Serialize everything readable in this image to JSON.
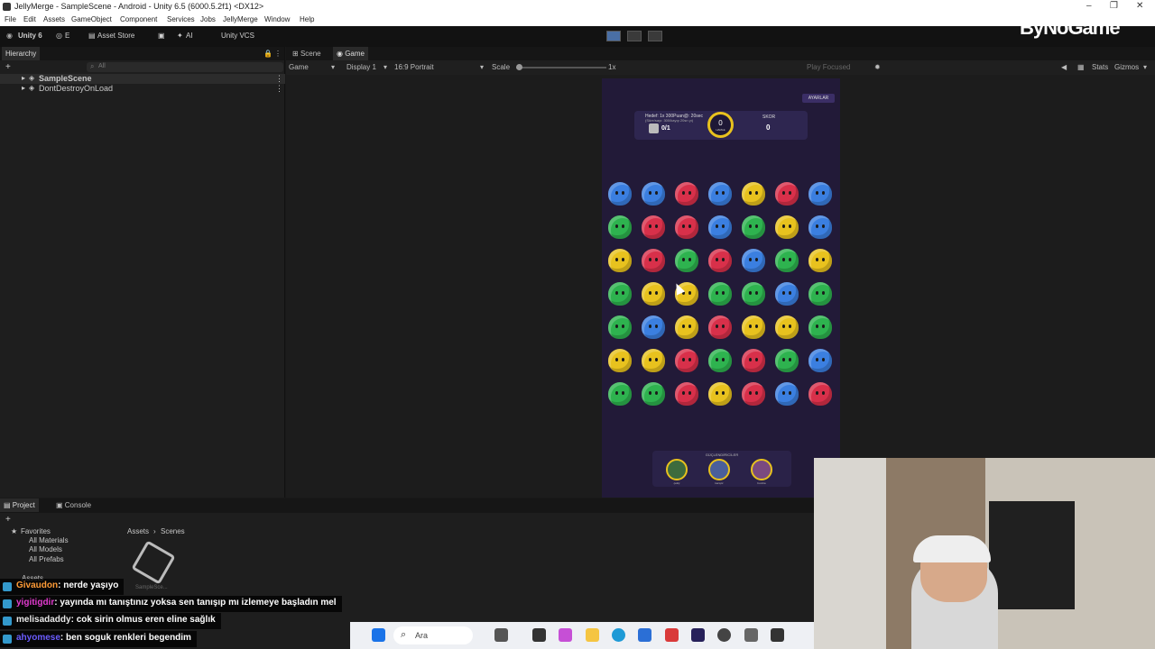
{
  "window": {
    "title": "JellyMerge - SampleScene - Android - Unity 6.5 (6000.5.2f1) <DX12>"
  },
  "menu": [
    "File",
    "Edit",
    "Assets",
    "GameObject",
    "Component",
    "Services",
    "Jobs",
    "JellyMerge",
    "Window",
    "Help"
  ],
  "toolbar": {
    "account": "Unity 6",
    "edit": "E",
    "asset_store": "Asset Store",
    "ai": "AI",
    "vcs": "Unity VCS"
  },
  "hierarchy": {
    "tab": "Hierarchy",
    "search_placeholder": "All",
    "items": [
      "SampleScene",
      "DontDestroyOnLoad"
    ]
  },
  "view_tabs": {
    "scene": "Scene",
    "game": "Game"
  },
  "game_bar": {
    "mode": "Game",
    "display": "Display 1",
    "aspect": "16:9 Portrait",
    "scale_label": "Scale",
    "scale_value": "1x",
    "play_focused": "Play Focused",
    "stats": "Stats",
    "gizmos": "Gizmos"
  },
  "game": {
    "settings_button": "AYARLAR",
    "goal_text": "Hedef: 1x 300Puan@: 20sec",
    "goal_sub": "(Süre/sayı: 300/kayıp 20sn yı)",
    "goal_progress": "0/1",
    "center_value": "0",
    "center_label": "HAMLE",
    "score_label": "SKOR",
    "score_value": "0",
    "grid": [
      [
        "blue",
        "blue",
        "red",
        "blue",
        "yellow",
        "red",
        "blue"
      ],
      [
        "green",
        "red",
        "red",
        "blue",
        "green",
        "yellow",
        "blue"
      ],
      [
        "yellow",
        "red",
        "green",
        "red",
        "blue",
        "green",
        "yellow"
      ],
      [
        "green",
        "yellow",
        "yellow",
        "green",
        "green",
        "blue",
        "green"
      ],
      [
        "green",
        "blue",
        "yellow",
        "red",
        "yellow",
        "yellow",
        "green"
      ],
      [
        "yellow",
        "yellow",
        "red",
        "green",
        "red",
        "green",
        "blue"
      ],
      [
        "green",
        "green",
        "red",
        "yellow",
        "red",
        "blue",
        "red"
      ]
    ],
    "boosters_title": "GÜÇLENDİRİCİLER",
    "boosters": [
      "çekiç",
      "karıştır",
      "bomba"
    ],
    "colors": {
      "blue": "#3b7fe0",
      "red": "#d8304a",
      "green": "#2eb34f",
      "yellow": "#e8c21e"
    }
  },
  "project": {
    "tab_project": "Project",
    "tab_console": "Console",
    "favorites": "Favorites",
    "fav_items": [
      "All Materials",
      "All Models",
      "All Prefabs"
    ],
    "breadcrumb_root": "Assets",
    "breadcrumb_leaf": "Scenes",
    "assets_label": "Assets",
    "asset_name": "SampleSce..."
  },
  "chat": [
    {
      "user": "Givaudon",
      "text": ": nerde yaşıyo",
      "color": "#ff9b37"
    },
    {
      "user": "yigitigdir",
      "text": ": yayında mı tanıştınız yoksa sen tanışıp mı izlemeye başladın mel",
      "color": "#e33bd0"
    },
    {
      "user": "melisadaddy",
      "text": ": cok sirin olmus eren eline sağlık",
      "color": "#e8e8e8"
    },
    {
      "user": "ahyomese",
      "text": ": ben soguk renkleri begendim",
      "color": "#6b5cff"
    }
  ],
  "taskbar": {
    "search": "Ara"
  },
  "brand": "ByNoGame"
}
